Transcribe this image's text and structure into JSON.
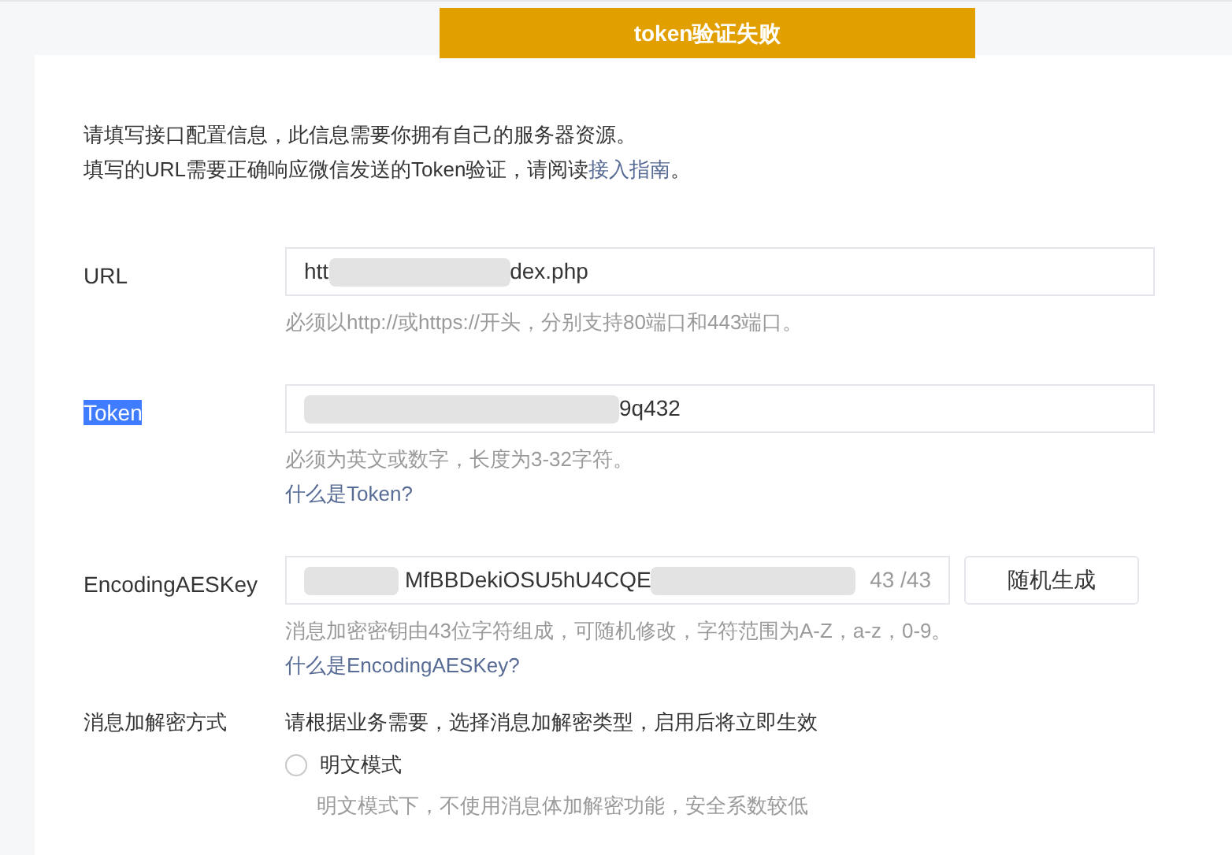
{
  "banner": {
    "text": "token验证失败"
  },
  "intro": {
    "line_1": "请填写接口配置信息，此信息需要你拥有自己的服务器资源。",
    "line_2": "填写的URL需要正确响应微信发送的Token验证，请阅读",
    "link": "接入指南",
    "line_2_end": "。"
  },
  "fields": [
    {
      "kind": "text",
      "label": "URL",
      "label_highlighted": false,
      "value_start": "htt",
      "value_end": "dex.php",
      "hint": "必须以http://或https://开头，分别支持80端口和443端口。"
    },
    {
      "kind": "text",
      "label": "Token",
      "label_highlighted": true,
      "value_end": "9q432",
      "hint": "必须为英文或数字，长度为3-32字符。",
      "link": "什么是Token?"
    },
    {
      "kind": "key",
      "label": "EncodingAESKey",
      "label_highlighted": false,
      "value_middle": "MfBBDekiOSU5hU4CQE",
      "counter": "43 /43",
      "button": "随机生成",
      "hint": "消息加密密钥由43位字符组成，可随机修改，字符范围为A-Z，a-z，0-9。",
      "link": "什么是EncodingAESKey?"
    }
  ],
  "mode": {
    "label": "消息加解密方式",
    "description": "请根据业务需要，选择消息加解密类型，启用后将立即生效",
    "options": [
      {
        "label": "明文模式",
        "selected": false,
        "hint": "明文模式下，不使用消息体加解密功能，安全系数较低"
      }
    ]
  }
}
